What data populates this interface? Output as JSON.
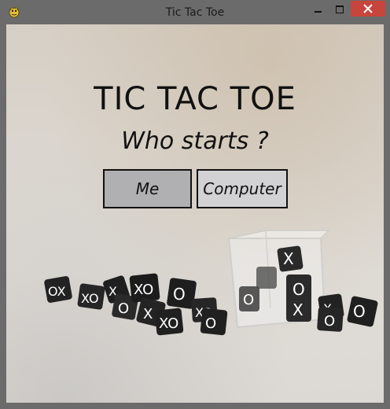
{
  "window": {
    "title": "Tic Tac Toe"
  },
  "screen": {
    "heading": "TIC TAC TOE",
    "question": "Who starts ?"
  },
  "choices": {
    "me_label": "Me",
    "computer_label": "Computer"
  },
  "colors": {
    "titlebar": "#6b6b6b",
    "close_button": "#c7453c",
    "me_button": "#b0b0b2",
    "computer_button": "#d2d2d4",
    "text": "#111111"
  },
  "icons": {
    "app": "python-snake-icon",
    "minimize": "minimize-icon",
    "maximize": "maximize-icon",
    "close": "close-icon"
  }
}
